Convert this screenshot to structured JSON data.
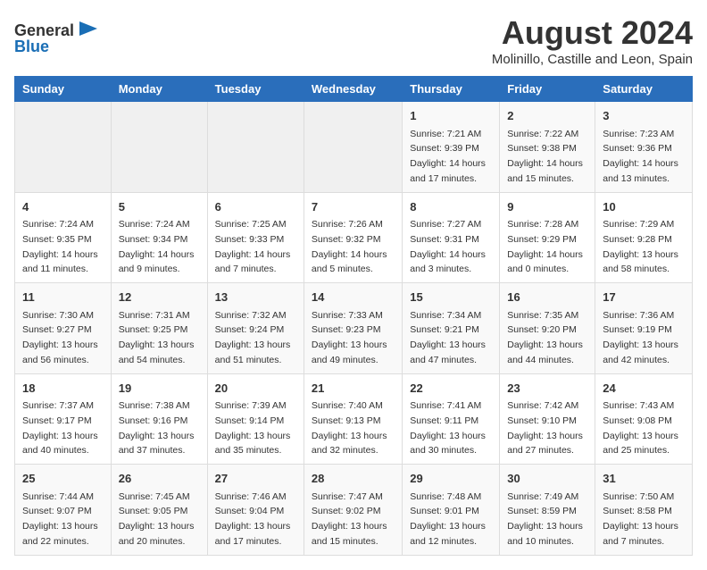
{
  "header": {
    "logo_general": "General",
    "logo_blue": "Blue",
    "title": "August 2024",
    "subtitle": "Molinillo, Castille and Leon, Spain"
  },
  "weekdays": [
    "Sunday",
    "Monday",
    "Tuesday",
    "Wednesday",
    "Thursday",
    "Friday",
    "Saturday"
  ],
  "weeks": [
    [
      {
        "day": "",
        "sunrise": "",
        "sunset": "",
        "daylight": ""
      },
      {
        "day": "",
        "sunrise": "",
        "sunset": "",
        "daylight": ""
      },
      {
        "day": "",
        "sunrise": "",
        "sunset": "",
        "daylight": ""
      },
      {
        "day": "",
        "sunrise": "",
        "sunset": "",
        "daylight": ""
      },
      {
        "day": "1",
        "sunrise": "Sunrise: 7:21 AM",
        "sunset": "Sunset: 9:39 PM",
        "daylight": "Daylight: 14 hours and 17 minutes."
      },
      {
        "day": "2",
        "sunrise": "Sunrise: 7:22 AM",
        "sunset": "Sunset: 9:38 PM",
        "daylight": "Daylight: 14 hours and 15 minutes."
      },
      {
        "day": "3",
        "sunrise": "Sunrise: 7:23 AM",
        "sunset": "Sunset: 9:36 PM",
        "daylight": "Daylight: 14 hours and 13 minutes."
      }
    ],
    [
      {
        "day": "4",
        "sunrise": "Sunrise: 7:24 AM",
        "sunset": "Sunset: 9:35 PM",
        "daylight": "Daylight: 14 hours and 11 minutes."
      },
      {
        "day": "5",
        "sunrise": "Sunrise: 7:24 AM",
        "sunset": "Sunset: 9:34 PM",
        "daylight": "Daylight: 14 hours and 9 minutes."
      },
      {
        "day": "6",
        "sunrise": "Sunrise: 7:25 AM",
        "sunset": "Sunset: 9:33 PM",
        "daylight": "Daylight: 14 hours and 7 minutes."
      },
      {
        "day": "7",
        "sunrise": "Sunrise: 7:26 AM",
        "sunset": "Sunset: 9:32 PM",
        "daylight": "Daylight: 14 hours and 5 minutes."
      },
      {
        "day": "8",
        "sunrise": "Sunrise: 7:27 AM",
        "sunset": "Sunset: 9:31 PM",
        "daylight": "Daylight: 14 hours and 3 minutes."
      },
      {
        "day": "9",
        "sunrise": "Sunrise: 7:28 AM",
        "sunset": "Sunset: 9:29 PM",
        "daylight": "Daylight: 14 hours and 0 minutes."
      },
      {
        "day": "10",
        "sunrise": "Sunrise: 7:29 AM",
        "sunset": "Sunset: 9:28 PM",
        "daylight": "Daylight: 13 hours and 58 minutes."
      }
    ],
    [
      {
        "day": "11",
        "sunrise": "Sunrise: 7:30 AM",
        "sunset": "Sunset: 9:27 PM",
        "daylight": "Daylight: 13 hours and 56 minutes."
      },
      {
        "day": "12",
        "sunrise": "Sunrise: 7:31 AM",
        "sunset": "Sunset: 9:25 PM",
        "daylight": "Daylight: 13 hours and 54 minutes."
      },
      {
        "day": "13",
        "sunrise": "Sunrise: 7:32 AM",
        "sunset": "Sunset: 9:24 PM",
        "daylight": "Daylight: 13 hours and 51 minutes."
      },
      {
        "day": "14",
        "sunrise": "Sunrise: 7:33 AM",
        "sunset": "Sunset: 9:23 PM",
        "daylight": "Daylight: 13 hours and 49 minutes."
      },
      {
        "day": "15",
        "sunrise": "Sunrise: 7:34 AM",
        "sunset": "Sunset: 9:21 PM",
        "daylight": "Daylight: 13 hours and 47 minutes."
      },
      {
        "day": "16",
        "sunrise": "Sunrise: 7:35 AM",
        "sunset": "Sunset: 9:20 PM",
        "daylight": "Daylight: 13 hours and 44 minutes."
      },
      {
        "day": "17",
        "sunrise": "Sunrise: 7:36 AM",
        "sunset": "Sunset: 9:19 PM",
        "daylight": "Daylight: 13 hours and 42 minutes."
      }
    ],
    [
      {
        "day": "18",
        "sunrise": "Sunrise: 7:37 AM",
        "sunset": "Sunset: 9:17 PM",
        "daylight": "Daylight: 13 hours and 40 minutes."
      },
      {
        "day": "19",
        "sunrise": "Sunrise: 7:38 AM",
        "sunset": "Sunset: 9:16 PM",
        "daylight": "Daylight: 13 hours and 37 minutes."
      },
      {
        "day": "20",
        "sunrise": "Sunrise: 7:39 AM",
        "sunset": "Sunset: 9:14 PM",
        "daylight": "Daylight: 13 hours and 35 minutes."
      },
      {
        "day": "21",
        "sunrise": "Sunrise: 7:40 AM",
        "sunset": "Sunset: 9:13 PM",
        "daylight": "Daylight: 13 hours and 32 minutes."
      },
      {
        "day": "22",
        "sunrise": "Sunrise: 7:41 AM",
        "sunset": "Sunset: 9:11 PM",
        "daylight": "Daylight: 13 hours and 30 minutes."
      },
      {
        "day": "23",
        "sunrise": "Sunrise: 7:42 AM",
        "sunset": "Sunset: 9:10 PM",
        "daylight": "Daylight: 13 hours and 27 minutes."
      },
      {
        "day": "24",
        "sunrise": "Sunrise: 7:43 AM",
        "sunset": "Sunset: 9:08 PM",
        "daylight": "Daylight: 13 hours and 25 minutes."
      }
    ],
    [
      {
        "day": "25",
        "sunrise": "Sunrise: 7:44 AM",
        "sunset": "Sunset: 9:07 PM",
        "daylight": "Daylight: 13 hours and 22 minutes."
      },
      {
        "day": "26",
        "sunrise": "Sunrise: 7:45 AM",
        "sunset": "Sunset: 9:05 PM",
        "daylight": "Daylight: 13 hours and 20 minutes."
      },
      {
        "day": "27",
        "sunrise": "Sunrise: 7:46 AM",
        "sunset": "Sunset: 9:04 PM",
        "daylight": "Daylight: 13 hours and 17 minutes."
      },
      {
        "day": "28",
        "sunrise": "Sunrise: 7:47 AM",
        "sunset": "Sunset: 9:02 PM",
        "daylight": "Daylight: 13 hours and 15 minutes."
      },
      {
        "day": "29",
        "sunrise": "Sunrise: 7:48 AM",
        "sunset": "Sunset: 9:01 PM",
        "daylight": "Daylight: 13 hours and 12 minutes."
      },
      {
        "day": "30",
        "sunrise": "Sunrise: 7:49 AM",
        "sunset": "Sunset: 8:59 PM",
        "daylight": "Daylight: 13 hours and 10 minutes."
      },
      {
        "day": "31",
        "sunrise": "Sunrise: 7:50 AM",
        "sunset": "Sunset: 8:58 PM",
        "daylight": "Daylight: 13 hours and 7 minutes."
      }
    ]
  ]
}
